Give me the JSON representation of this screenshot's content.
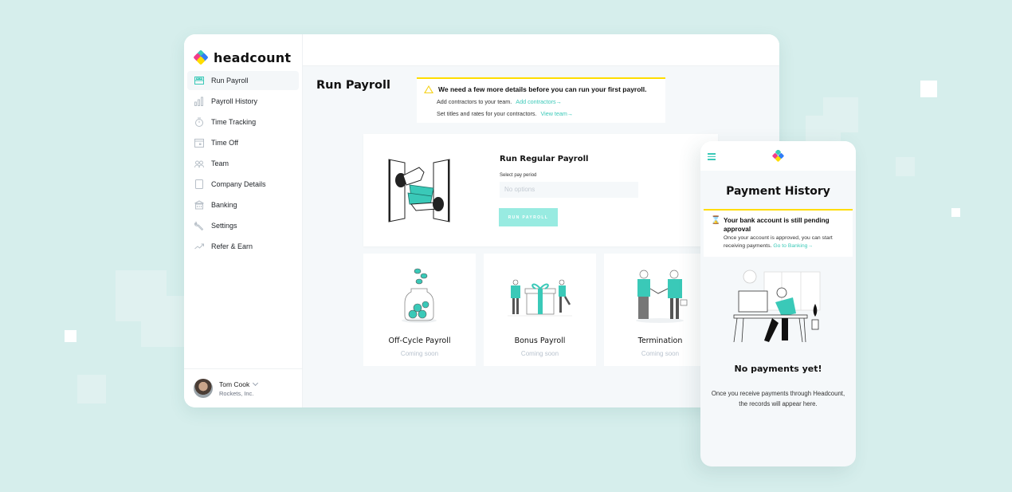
{
  "app": {
    "name": "headcount"
  },
  "sidebar": {
    "items": [
      {
        "label": "Run Payroll",
        "icon": "payroll-icon",
        "active": true
      },
      {
        "label": "Payroll History",
        "icon": "bar-chart-icon",
        "active": false
      },
      {
        "label": "Time Tracking",
        "icon": "stopwatch-icon",
        "active": false
      },
      {
        "label": "Time Off",
        "icon": "calendar-icon",
        "active": false
      },
      {
        "label": "Team",
        "icon": "people-icon",
        "active": false
      },
      {
        "label": "Company Details",
        "icon": "clipboard-icon",
        "active": false
      },
      {
        "label": "Banking",
        "icon": "bank-icon",
        "active": false
      },
      {
        "label": "Settings",
        "icon": "wrench-icon",
        "active": false
      },
      {
        "label": "Refer & Earn",
        "icon": "trend-icon",
        "active": false
      }
    ],
    "profile": {
      "name": "Tom Cook",
      "company": "Rockets, Inc."
    }
  },
  "main": {
    "title": "Run Payroll",
    "alert": {
      "heading": "We need a few more details before you can run your first payroll.",
      "lines": [
        {
          "text": "Add contractors to your team.",
          "link": "Add contractors→"
        },
        {
          "text": "Set titles and rates for your contractors.",
          "link": "View team→"
        }
      ]
    },
    "regular": {
      "title": "Run Regular Payroll",
      "select_label": "Select pay period",
      "select_placeholder": "No options",
      "button": "RUN PAYROLL"
    },
    "cards": [
      {
        "title": "Off-Cycle Payroll",
        "subtitle": "Coming soon"
      },
      {
        "title": "Bonus Payroll",
        "subtitle": "Coming soon"
      },
      {
        "title": "Termination",
        "subtitle": "Coming soon"
      }
    ]
  },
  "phone": {
    "title": "Payment History",
    "alert": {
      "heading": "Your bank account is still pending approval",
      "body": "Once your account is approved, you can start receiving payments.",
      "link": "Go to Banking→"
    },
    "empty_title": "No payments yet!",
    "empty_body": "Once you receive payments through Headcount, the records will appear here."
  },
  "colors": {
    "accent": "#3ac9b8",
    "warning": "#ffdd00",
    "background": "#d6eeec"
  }
}
